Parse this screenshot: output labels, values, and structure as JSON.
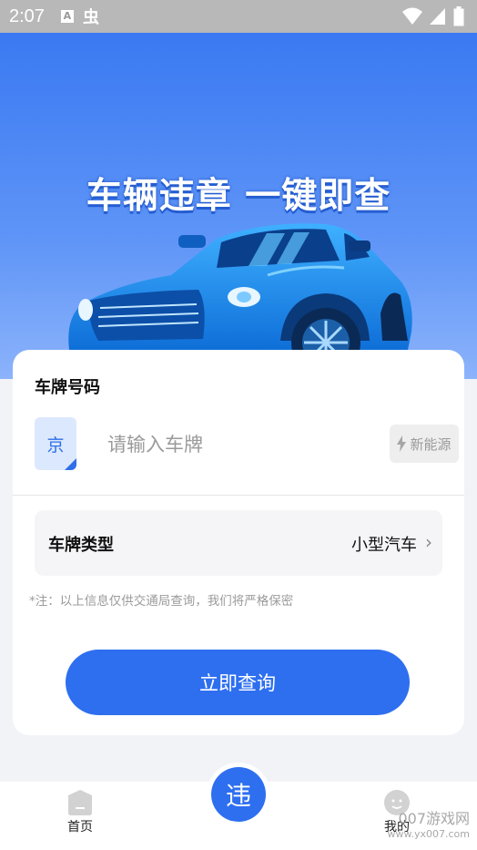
{
  "status": {
    "time": "2:07",
    "a_icon": "A",
    "bug_icon": "虫"
  },
  "hero": {
    "title": "车辆违章 一键即查"
  },
  "form": {
    "plate_label": "车牌号码",
    "province": "京",
    "plate_placeholder": "请输入车牌",
    "new_energy": "新能源",
    "type_label": "车牌类型",
    "type_value": "小型汽车",
    "note": "*注：以上信息仅供交通局查询，我们将严格保密",
    "query_button": "立即查询"
  },
  "tabbar": {
    "home": "首页",
    "center_icon": "违",
    "mine": "我的"
  },
  "watermark": {
    "line1": "007游戏网",
    "line2": "www.yx007.com"
  },
  "colors": {
    "accent": "#2e6ff0",
    "hero_top": "#3a79f2",
    "car": "#1c8ff0"
  },
  "icons": [
    "wifi-icon",
    "signal-icon",
    "battery-icon",
    "bolt-icon",
    "chevron-right-icon",
    "home-icon",
    "profile-icon"
  ]
}
